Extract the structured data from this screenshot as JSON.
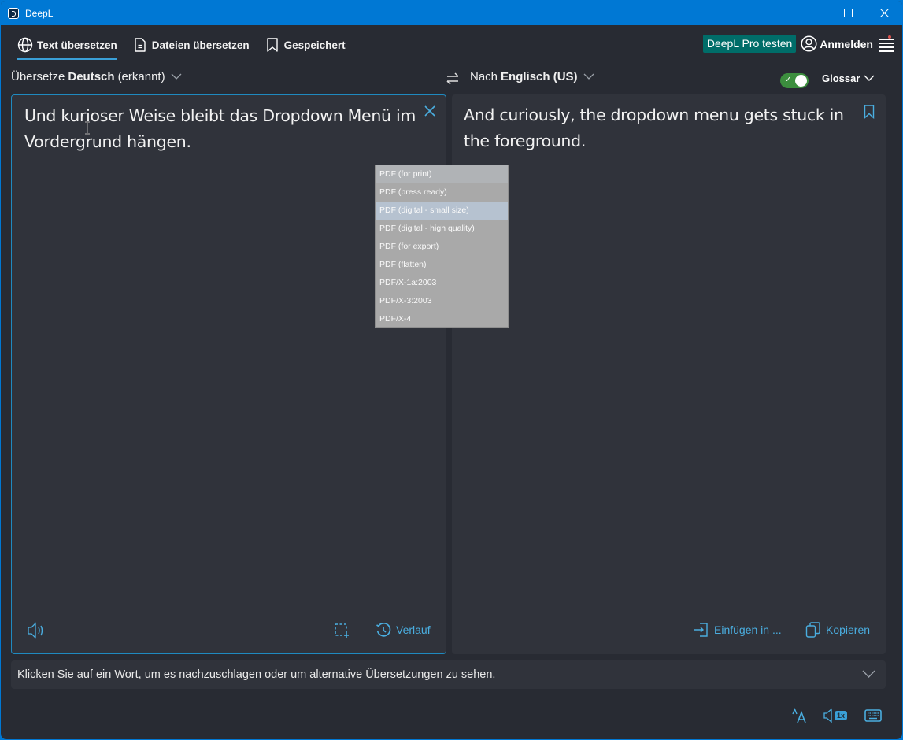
{
  "window": {
    "title": "DeepL",
    "controls": [
      "minimize",
      "maximize",
      "close"
    ]
  },
  "nav": {
    "tabs": [
      {
        "label": "Text übersetzen",
        "icon": "globe-icon",
        "active": true
      },
      {
        "label": "Dateien übersetzen",
        "icon": "document-icon",
        "active": false
      },
      {
        "label": "Gespeichert",
        "icon": "bookmark-icon",
        "active": false
      }
    ],
    "pro_button": "DeepL Pro testen",
    "login_label": "Anmelden",
    "menu_icon": "hamburger-menu-icon"
  },
  "languages": {
    "source_prefix": "Übersetze",
    "source_lang": "Deutsch",
    "source_suffix": "(erkannt)",
    "target_prefix": "Nach",
    "target_lang": "Englisch (US)",
    "formality_toggle_on": true,
    "glossary_label": "Glossar"
  },
  "source_panel": {
    "text": "Und kurioser Weise bleibt das Dropdown Menü im Vordergrund hängen.",
    "history_label": "Verlauf"
  },
  "target_panel": {
    "text": "And curiously, the dropdown menu gets stuck in the foreground.",
    "insert_label": "Einfügen in ...",
    "copy_label": "Kopieren"
  },
  "hint": {
    "text": "Klicken Sie auf ein Wort, um es nachzuschlagen oder um alternative Übersetzungen zu sehen."
  },
  "bottom_bar": {
    "speech_speed": "1x"
  },
  "dropdown": {
    "highlighted_index": 2,
    "items": [
      "PDF (for print)",
      "PDF (press ready)",
      "PDF (digital - small size)",
      "PDF (digital - high quality)",
      "PDF (for export)",
      "PDF (flatten)",
      "PDF/X-1a:2003",
      "PDF/X-3:2003",
      "PDF/X-4"
    ]
  },
  "colors": {
    "titlebar": "#0078d4",
    "background": "#282b33",
    "panel": "#30333b",
    "accent": "#4aaee0",
    "pro_button": "#006d69",
    "toggle_on": "#3c8e3e",
    "dropdown_bg": "#a9a9a9",
    "dropdown_highlight": "#b6c2d0"
  }
}
